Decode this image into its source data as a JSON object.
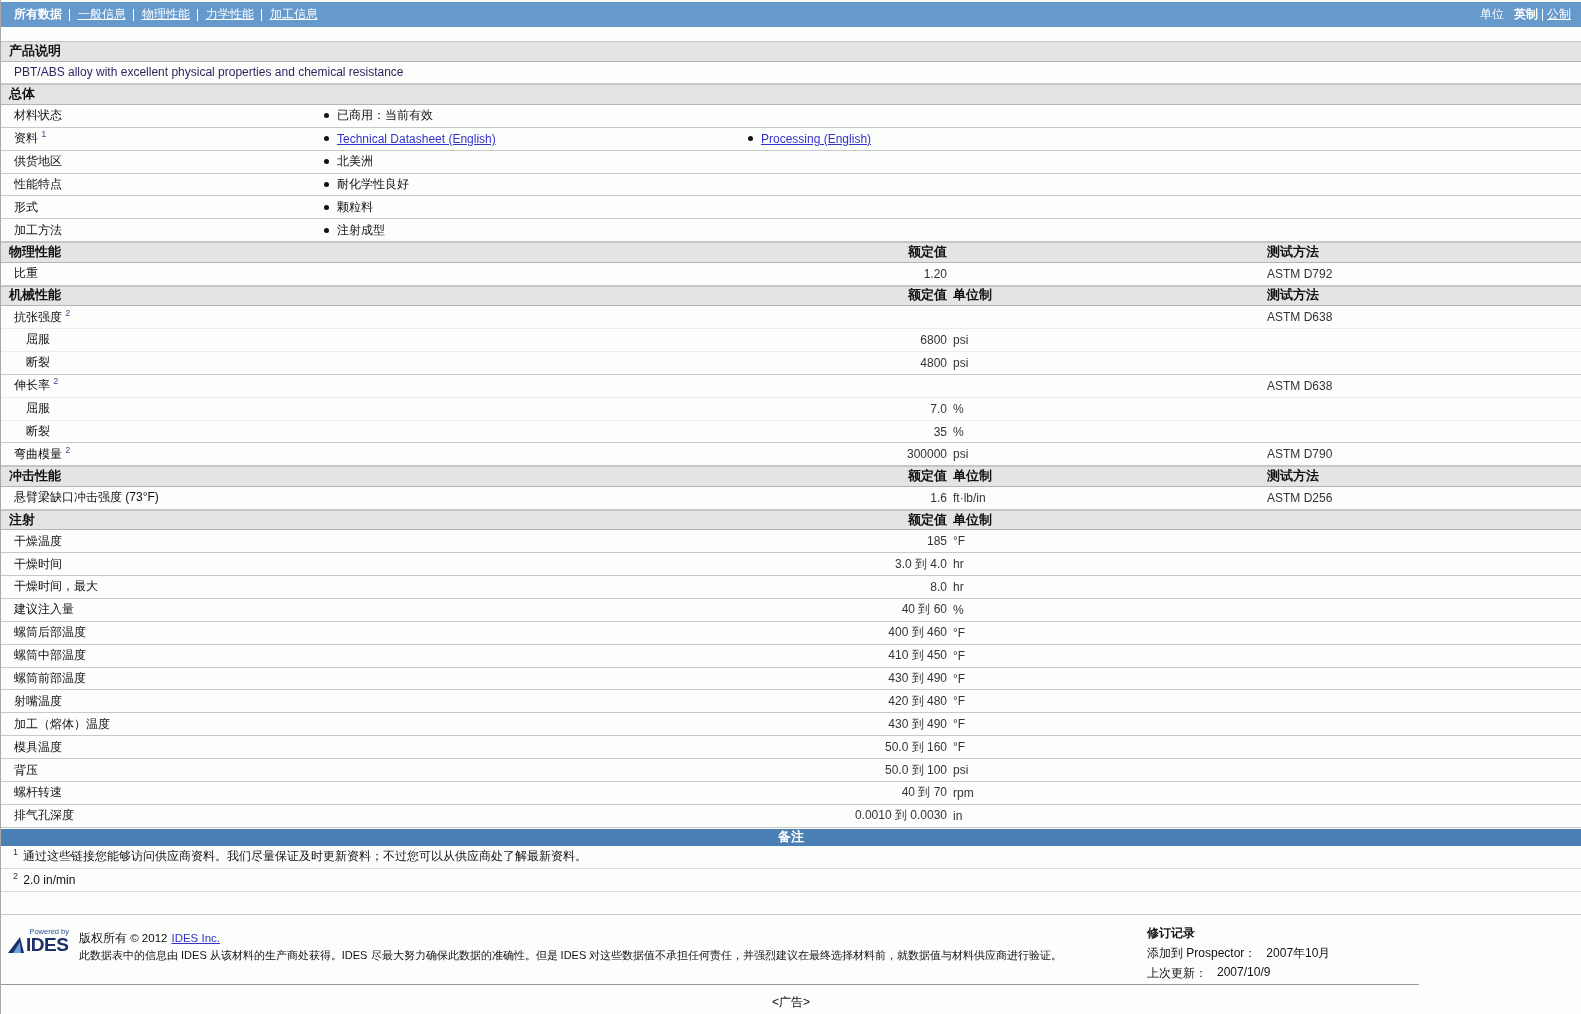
{
  "top_bar": {
    "tabs": [
      {
        "label": "所有数据",
        "selected": true
      },
      {
        "label": "一般信息",
        "selected": false
      },
      {
        "label": "物理性能",
        "selected": false
      },
      {
        "label": "力学性能",
        "selected": false
      },
      {
        "label": "加工信息",
        "selected": false
      }
    ],
    "unit_label": "单位",
    "units": [
      {
        "label": "英制",
        "selected": true
      },
      {
        "label": "公制",
        "selected": false
      }
    ]
  },
  "sections": [
    {
      "kind": "description",
      "title": "产品说明",
      "text": "PBT/ABS alloy with excellent physical properties and chemical resistance"
    },
    {
      "kind": "general",
      "title": "总体",
      "rows": [
        {
          "label": "材料状态",
          "items": [
            {
              "text": "已商用：当前有效",
              "link": false
            }
          ]
        },
        {
          "label": "资料 $^{1}$",
          "items": [
            {
              "text": "Technical Datasheet (English)",
              "link": true
            },
            {
              "text": "Processing (English)",
              "link": true
            }
          ]
        },
        {
          "label": "供货地区",
          "items": [
            {
              "text": "北美洲",
              "link": false
            }
          ]
        },
        {
          "label": "性能特点",
          "items": [
            {
              "text": "耐化学性良好",
              "link": false
            }
          ]
        },
        {
          "label": "形式",
          "items": [
            {
              "text": "颗粒料",
              "link": false
            }
          ]
        },
        {
          "label": "加工方法",
          "items": [
            {
              "text": "注射成型",
              "link": false
            }
          ]
        }
      ]
    },
    {
      "kind": "properties",
      "title": "物理性能",
      "columns": {
        "value": "额定值",
        "method": "测试方法"
      },
      "rows": [
        {
          "label": "比重",
          "value": "1.20",
          "method": "ASTM D792"
        }
      ]
    },
    {
      "kind": "properties",
      "title": "机械性能",
      "columns": {
        "value": "额定值",
        "unit": "单位制",
        "method": "测试方法"
      },
      "rows": [
        {
          "label": "抗张强度 $^{2}$",
          "method": "ASTM D638",
          "children": [
            {
              "label": "屈服",
              "value": "6800",
              "unit": "psi"
            },
            {
              "label": "断裂",
              "value": "4800",
              "unit": "psi"
            }
          ]
        },
        {
          "label": "伸长率 $^{2}$",
          "method": "ASTM D638",
          "children": [
            {
              "label": "屈服",
              "value": "7.0",
              "unit": "%"
            },
            {
              "label": "断裂",
              "value": "35",
              "unit": "%"
            }
          ]
        },
        {
          "label": "弯曲模量 $^{2}$",
          "value": "300000",
          "unit": "psi",
          "method": "ASTM D790"
        }
      ]
    },
    {
      "kind": "properties",
      "title": "冲击性能",
      "columns": {
        "value": "额定值",
        "unit": "单位制",
        "method": "测试方法"
      },
      "rows": [
        {
          "label": "悬臂梁缺口冲击强度 (73°F)",
          "value": "1.6",
          "unit": "ft·lb/in",
          "method": "ASTM D256"
        }
      ]
    },
    {
      "kind": "properties",
      "title": "注射",
      "columns": {
        "value": "额定值",
        "unit": "单位制"
      },
      "rows": [
        {
          "label": "干燥温度",
          "value": "185",
          "unit": "°F"
        },
        {
          "label": "干燥时间",
          "value": "3.0 到 4.0",
          "unit": "hr"
        },
        {
          "label": "干燥时间，最大",
          "value": "8.0",
          "unit": "hr"
        },
        {
          "label": "建议注入量",
          "value": "40 到 60",
          "unit": "%"
        },
        {
          "label": "螺筒后部温度",
          "value": "400 到 460",
          "unit": "°F"
        },
        {
          "label": "螺筒中部温度",
          "value": "410 到 450",
          "unit": "°F"
        },
        {
          "label": "螺筒前部温度",
          "value": "430 到 490",
          "unit": "°F"
        },
        {
          "label": "射嘴温度",
          "value": "420 到 480",
          "unit": "°F"
        },
        {
          "label": "加工（熔体）温度",
          "value": "430 到 490",
          "unit": "°F"
        },
        {
          "label": "模具温度",
          "value": "50.0 到 160",
          "unit": "°F"
        },
        {
          "label": "背压",
          "value": "50.0 到 100",
          "unit": "psi"
        },
        {
          "label": "螺杆转速",
          "value": "40 到 70",
          "unit": "rpm"
        },
        {
          "label": "排气孔深度",
          "value": "0.0010 到 0.0030",
          "unit": "in"
        }
      ]
    }
  ],
  "notes": {
    "title": "备注",
    "items": [
      "$^{1}$ 通过这些链接您能够访问供应商资料。我们尽量保证及时更新资料；不过您可以从供应商处了解最新资料。",
      "$^{2}$ 2.0 in/min"
    ]
  },
  "footer": {
    "logo": {
      "tagline": "Powered by",
      "name": "IDES"
    },
    "copyright": "版权所有 © 2012",
    "company_link": "IDES Inc.",
    "disclaimer": "此数据表中的信息由 IDES 从该材料的生产商处获得。IDES 尽最大努力确保此数据的准确性。但是 IDES 对这些数据值不承担任何责任，并强烈建议在最终选择材料前，就数据值与材料供应商进行验证。",
    "revision": {
      "title": "修订记录",
      "rows": [
        {
          "label": "添加到 Prospector：",
          "value": "2007年10月"
        },
        {
          "label": "上次更新：",
          "value": "2007/10/9"
        }
      ]
    },
    "ad": "<广告>"
  }
}
